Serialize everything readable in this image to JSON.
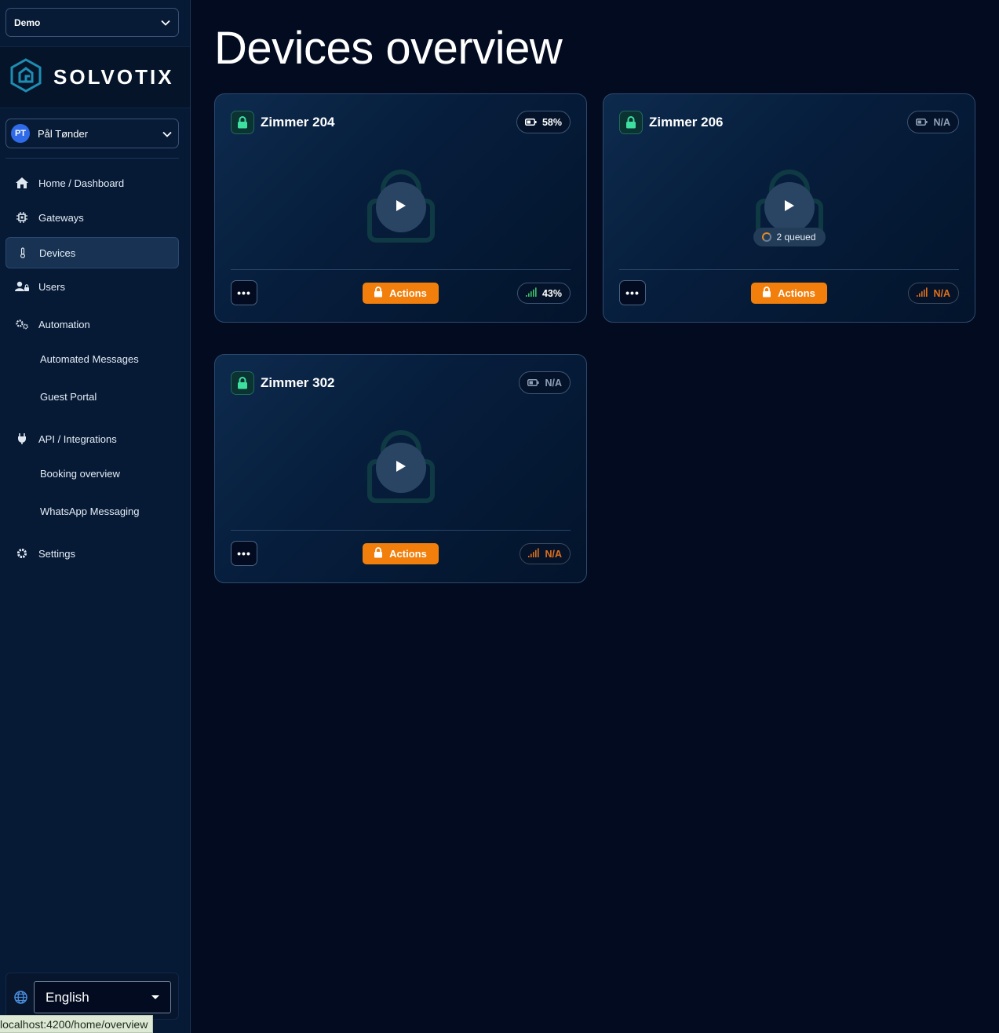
{
  "sidebar": {
    "org_select": "Demo",
    "brand": "SOLVOTIX",
    "user": {
      "initials": "PT",
      "name": "Pål Tønder"
    },
    "nav": [
      {
        "label": "Home / Dashboard",
        "icon": "home-icon"
      },
      {
        "label": "Gateways",
        "icon": "chip-icon"
      },
      {
        "label": "Devices",
        "icon": "thermometer-icon",
        "active": true
      },
      {
        "label": "Users",
        "icon": "user-lock-icon"
      },
      {
        "label": "Automation",
        "icon": "gears-icon"
      },
      {
        "label": "API / Integrations",
        "icon": "plug-icon"
      },
      {
        "label": "Settings",
        "icon": "gear-icon"
      }
    ],
    "automation_sub": [
      "Automated Messages",
      "Guest Portal"
    ],
    "api_sub": [
      "Booking overview",
      "WhatsApp Messaging"
    ],
    "language": "English"
  },
  "status_url": "localhost:4200/home/overview",
  "main": {
    "title": "Devices overview",
    "actions_label": "Actions",
    "devices": [
      {
        "name": "Zimmer 204",
        "battery": "58%",
        "signal": "43%",
        "signal_color": "#3fc36a",
        "queued": ""
      },
      {
        "name": "Zimmer 206",
        "battery": "N/A",
        "signal": "N/A",
        "signal_color": "#e0701a",
        "queued": "2 queued"
      },
      {
        "name": "Zimmer 302",
        "battery": "N/A",
        "signal": "N/A",
        "signal_color": "#e0701a",
        "queued": ""
      }
    ]
  },
  "colors": {
    "accent": "#f27f0c",
    "lock_green": "#3ee0a0",
    "signal_ok": "#3fc36a",
    "signal_na": "#e0701a"
  }
}
